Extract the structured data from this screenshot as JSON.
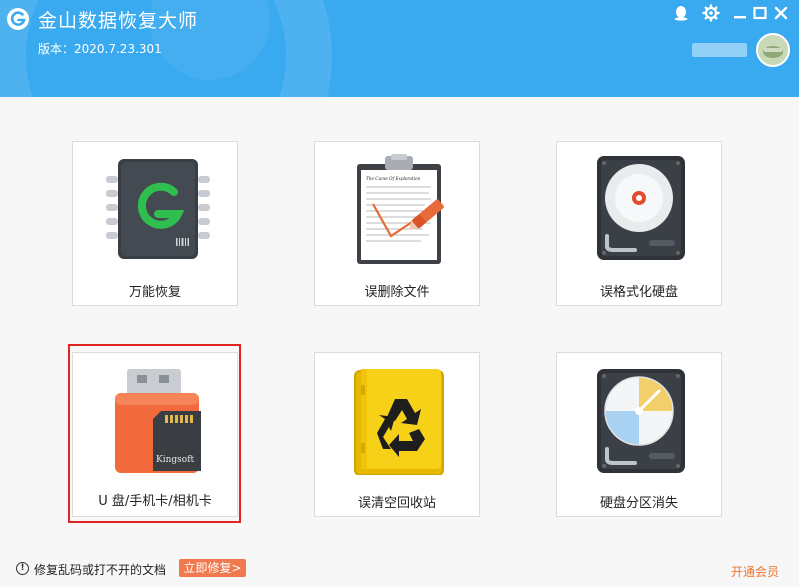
{
  "app": {
    "title": "金山数据恢复大师",
    "version": "版本：2020.7.23.301"
  },
  "header_icons": [
    "qq-icon",
    "gear-icon",
    "minimize-icon",
    "maximize-icon",
    "close-icon"
  ],
  "cards": [
    {
      "label": "万能恢复",
      "icon": "chip-g-icon"
    },
    {
      "label": "误删除文件",
      "icon": "clipboard-document-icon"
    },
    {
      "label": "误格式化硬盘",
      "icon": "hard-disk-icon"
    },
    {
      "label": "U 盘/手机卡/相机卡",
      "icon": "usb-sd-card-icon",
      "sd_brand": "Kingsoft",
      "selected": true
    },
    {
      "label": "误清空回收站",
      "icon": "recycle-bin-icon"
    },
    {
      "label": "硬盘分区消失",
      "icon": "partition-disk-icon"
    }
  ],
  "clipboard_doc_title": "The Curse Of Exploration",
  "footer": {
    "tip": "修复乱码或打不开的文档",
    "repair_button": "立即修复>",
    "member_link": "开通会员"
  },
  "colors": {
    "header": "#3aaaf0",
    "highlight": "#e02424",
    "repair_button": "#f07a4e",
    "member_link": "#f0762e"
  }
}
